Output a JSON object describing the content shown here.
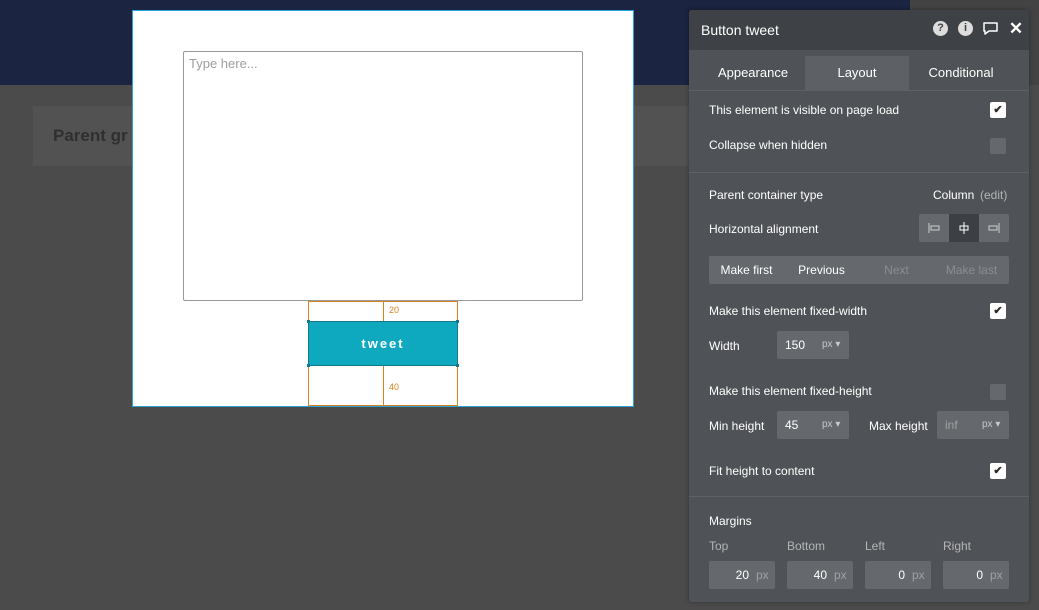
{
  "canvas": {
    "parent_group_label": "Parent gr",
    "textarea_placeholder": "Type here...",
    "button_label": "tweet",
    "margin_top_label": "20",
    "margin_bottom_label": "40"
  },
  "panel": {
    "title": "Button tweet",
    "header_icons": [
      "help-icon",
      "info-icon",
      "comment-icon",
      "close-icon"
    ],
    "tabs": [
      "Appearance",
      "Layout",
      "Conditional"
    ],
    "active_tab": "Layout",
    "visible_on_load": {
      "label": "This element is visible on page load",
      "checked": true
    },
    "collapse_when_hidden": {
      "label": "Collapse when hidden",
      "checked": false
    },
    "parent_container": {
      "label": "Parent container type",
      "value": "Column",
      "edit": "(edit)"
    },
    "horizontal_alignment": {
      "label": "Horizontal alignment",
      "options": [
        "align-left-icon",
        "align-center-icon",
        "align-right-icon"
      ],
      "selected": "align-center-icon"
    },
    "order_buttons": [
      "Make first",
      "Previous",
      "Next",
      "Make last"
    ],
    "fixed_width": {
      "label": "Make this element fixed-width",
      "checked": true
    },
    "width": {
      "label": "Width",
      "value": "150",
      "unit": "px"
    },
    "fixed_height": {
      "label": "Make this element fixed-height",
      "checked": false
    },
    "min_height": {
      "label": "Min height",
      "value": "45",
      "unit": "px"
    },
    "max_height": {
      "label": "Max height",
      "placeholder": "inf",
      "unit": "px"
    },
    "fit_height": {
      "label": "Fit height to content",
      "checked": true
    },
    "margins": {
      "label": "Margins",
      "top": {
        "label": "Top",
        "value": "20",
        "unit": "px"
      },
      "bottom": {
        "label": "Bottom",
        "value": "40",
        "unit": "px"
      },
      "left": {
        "label": "Left",
        "value": "0",
        "unit": "px"
      },
      "right": {
        "label": "Right",
        "value": "0",
        "unit": "px"
      }
    },
    "colors": {
      "accent": "#0ea9bf",
      "margin_guide": "#d9821f",
      "panel_bg": "#4f5357"
    }
  }
}
